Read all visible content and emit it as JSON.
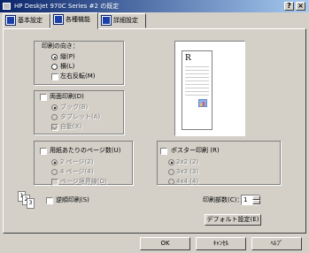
{
  "window": {
    "title": "HP DeskJet 970C Series #2 の既定",
    "help_label": "?",
    "close_label": "×"
  },
  "tabs": [
    {
      "label": "基本設定"
    },
    {
      "label": "各種機能"
    },
    {
      "label": "詳細設定"
    }
  ],
  "orientation": {
    "label": "印刷の向き：",
    "portrait": "縦(P)",
    "landscape": "横(L)",
    "rotate": "左右反転(M)",
    "selected": "portrait",
    "preview_letter": "R"
  },
  "duplex": {
    "label": "両面印刷(D)",
    "book": "ブック(B)",
    "tablet": "タブレット(A)",
    "auto": "自動(X)"
  },
  "pages_per_sheet": {
    "label": "用紙あたりのページ数(U)",
    "two": "2 ページ(2)",
    "four": "4 ページ(4)",
    "border": "ページ境界線(O)"
  },
  "poster": {
    "label": "ポスター印刷 (R)",
    "o1": "2x2 (2)",
    "o2": "3x3 (3)",
    "o3": "4x4 (4)"
  },
  "reverse": {
    "label": "逆順印刷(S)"
  },
  "copies": {
    "label": "印刷部数(C)：",
    "value": "1"
  },
  "buttons": {
    "default": "デフォルト設定(E)",
    "ok": "OK",
    "cancel": "ｷｬﾝｾﾙ",
    "help": "ﾍﾙﾌﾟ"
  }
}
